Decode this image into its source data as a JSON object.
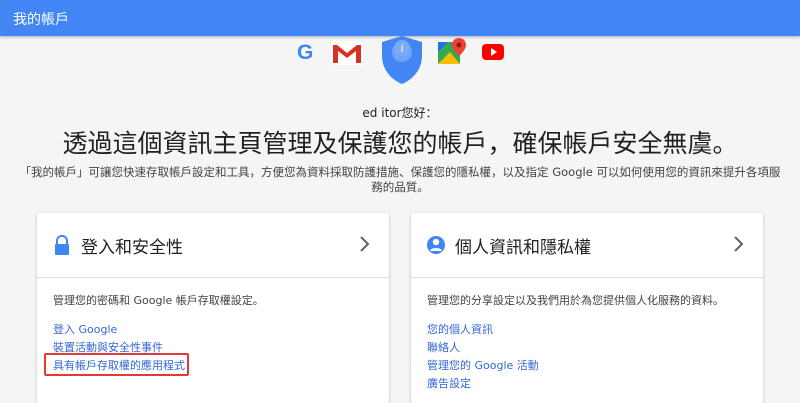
{
  "appbar": {
    "title": "我的帳戶"
  },
  "product_icons": [
    "google-g-icon",
    "gmail-icon",
    "account-shield-icon",
    "google-maps-icon",
    "youtube-icon"
  ],
  "brand": {
    "blue": "#4285f4",
    "link": "#3367d6",
    "highlight": "#e53935"
  },
  "shield_letter": "i",
  "g_letter": "G",
  "greeting": "ed itor您好：",
  "headline": "透過這個資訊主頁管理及保護您的帳戶，確保帳戶安全無虞。",
  "description": "「我的帳戶」可讓您快速存取帳戶設定和工具，方便您為資料採取防護措施、保護您的隱私權，以及指定 Google 可以如何使用您的資訊來提升各項服務的品質。",
  "cards": {
    "security": {
      "title": "登入和安全性",
      "description": "管理您的密碼和 Google 帳戶存取權設定。",
      "links": [
        "登入 Google",
        "裝置活動與安全性事件",
        "具有帳戶存取權的應用程式"
      ]
    },
    "privacy": {
      "title": "個人資訊和隱私權",
      "description": "管理您的分享設定以及我們用於為您提供個人化服務的資料。",
      "links": [
        "您的個人資訊",
        "聯絡人",
        "管理您的 Google 活動",
        "廣告設定"
      ]
    }
  }
}
